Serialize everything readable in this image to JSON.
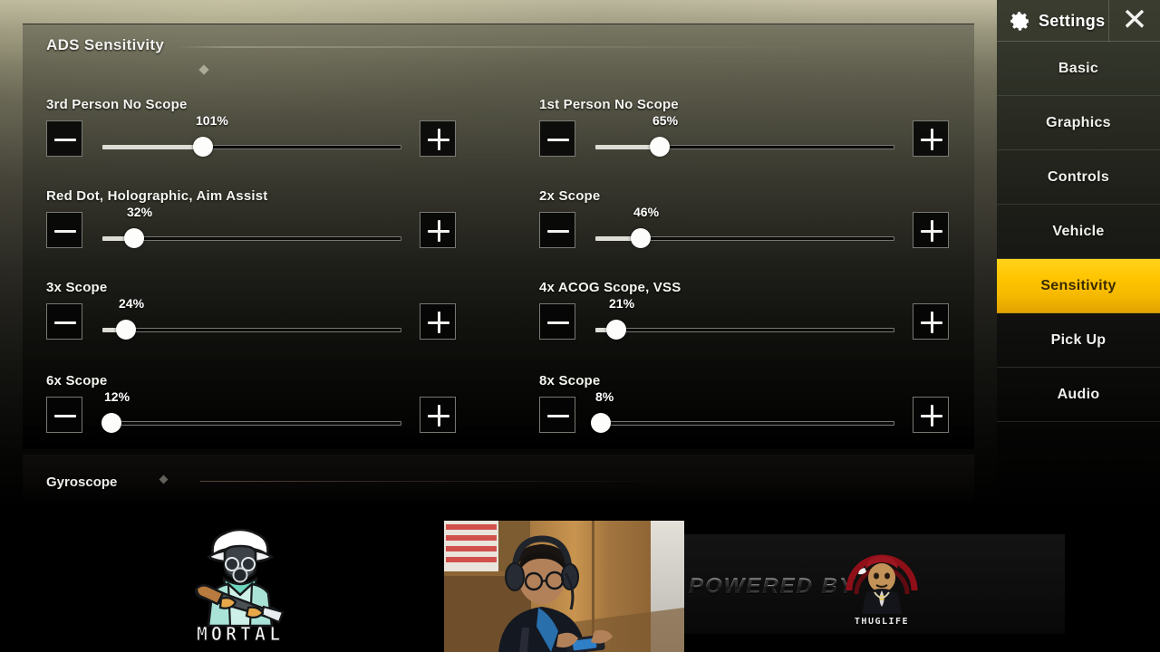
{
  "window": {
    "sidebar_title": "Settings",
    "gear_icon": "gear-icon",
    "close_icon": "close-icon"
  },
  "sidebar": {
    "items": [
      {
        "label": "Basic",
        "active": false
      },
      {
        "label": "Graphics",
        "active": false
      },
      {
        "label": "Controls",
        "active": false
      },
      {
        "label": "Vehicle",
        "active": false
      },
      {
        "label": "Sensitivity",
        "active": true
      },
      {
        "label": "Pick Up",
        "active": false
      },
      {
        "label": "Audio",
        "active": false
      }
    ],
    "active_color": "#ffc400",
    "active_text_color": "#3a2b00"
  },
  "main": {
    "section_title": "ADS Sensitivity",
    "sliders": [
      {
        "label": "3rd Person No Scope",
        "value": "101%",
        "percent": 101,
        "fill_ratio": 0.335,
        "minus_label": "minus-icon",
        "plus_label": "plus-icon"
      },
      {
        "label": "1st Person No Scope",
        "value": "65%",
        "percent": 65,
        "fill_ratio": 0.215,
        "minus_label": "minus-icon",
        "plus_label": "plus-icon"
      },
      {
        "label": "Red Dot, Holographic, Aim Assist",
        "value": "32%",
        "percent": 32,
        "fill_ratio": 0.105,
        "minus_label": "minus-icon",
        "plus_label": "plus-icon"
      },
      {
        "label": "2x Scope",
        "value": "46%",
        "percent": 46,
        "fill_ratio": 0.152,
        "minus_label": "minus-icon",
        "plus_label": "plus-icon"
      },
      {
        "label": "3x Scope",
        "value": "24%",
        "percent": 24,
        "fill_ratio": 0.079,
        "minus_label": "minus-icon",
        "plus_label": "plus-icon"
      },
      {
        "label": "4x ACOG Scope, VSS",
        "value": "21%",
        "percent": 21,
        "fill_ratio": 0.069,
        "minus_label": "minus-icon",
        "plus_label": "plus-icon"
      },
      {
        "label": "6x Scope",
        "value": "12%",
        "percent": 12,
        "fill_ratio": 0.03,
        "minus_label": "minus-icon",
        "plus_label": "plus-icon"
      },
      {
        "label": "8x Scope",
        "value": "8%",
        "percent": 8,
        "fill_ratio": 0.018,
        "minus_label": "minus-icon",
        "plus_label": "plus-icon"
      }
    ],
    "gyroscope_title": "Gyroscope"
  },
  "overlay": {
    "logo_name": "MORTAL",
    "powered_by_text": "POWERED BY",
    "sponsor_name": "THUGLIFE"
  }
}
